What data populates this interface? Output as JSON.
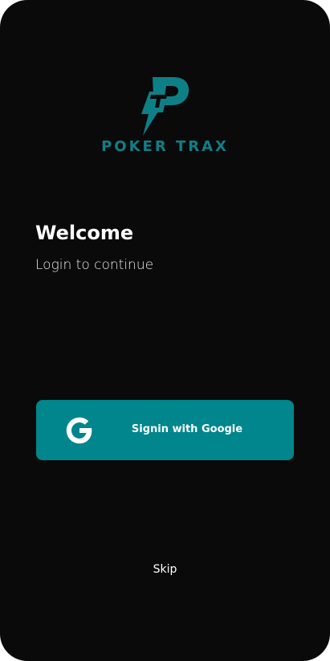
{
  "brand": {
    "name": "POKER TRAX",
    "logo_icon": "lightning-p-logo",
    "color": "#0f7f86"
  },
  "welcome": {
    "title": "Welcome",
    "subtitle": "Login to continue"
  },
  "actions": {
    "google_signin_label": "Signin with Google",
    "google_icon": "google-g-icon",
    "skip_label": "Skip"
  },
  "colors": {
    "background": "#0a0a0a",
    "accent": "#00868c",
    "text": "#ffffff"
  }
}
